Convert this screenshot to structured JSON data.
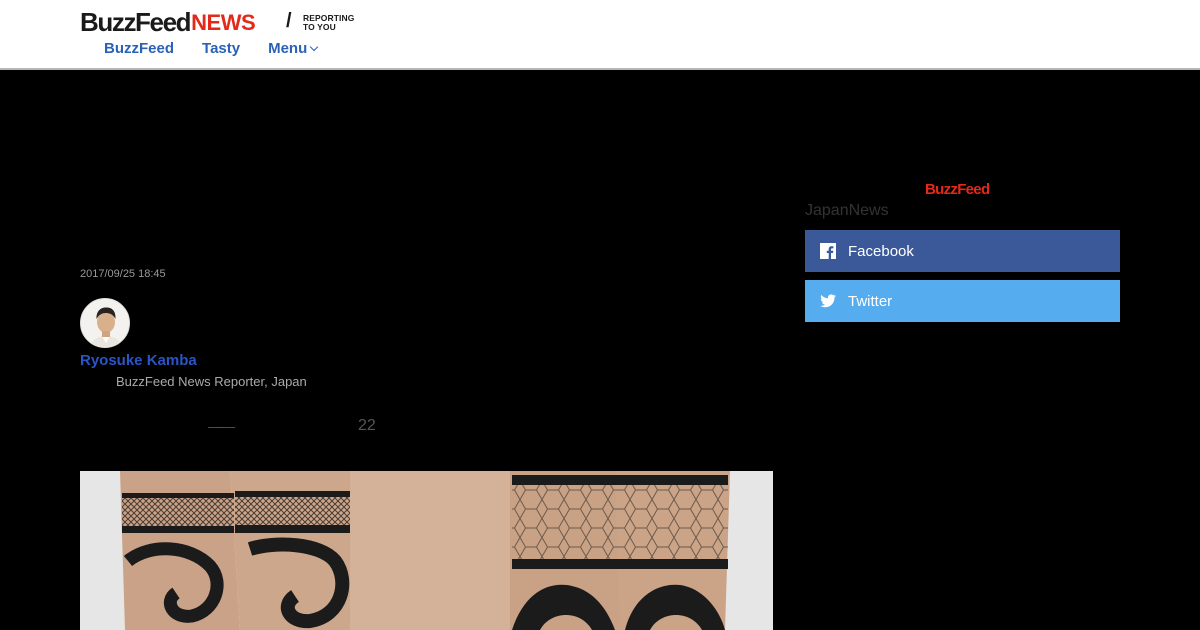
{
  "header": {
    "logo_primary": "BuzzFeed",
    "logo_secondary": "NEWS",
    "logo_tagline_1": "REPORTING",
    "logo_tagline_2": "TO YOU",
    "nav": [
      {
        "label": "BuzzFeed"
      },
      {
        "label": "Tasty"
      },
      {
        "label": "Menu"
      }
    ]
  },
  "article": {
    "date": "2017/09/25 18:45",
    "author_name": "Ryosuke Kamba",
    "author_role": "BuzzFeed News Reporter, Japan",
    "lead_dash": "——",
    "lead_number": "22"
  },
  "sidebar": {
    "brand": "BuzzFeed",
    "account": "JapanNews",
    "share": [
      {
        "label": "Facebook",
        "icon": "facebook-icon",
        "color": "#3b5998"
      },
      {
        "label": "Twitter",
        "icon": "twitter-icon",
        "color": "#55acee"
      }
    ]
  },
  "colors": {
    "accent_red": "#e32a1a",
    "link_blue": "#2a62b8",
    "author_blue": "#2a55c9"
  }
}
